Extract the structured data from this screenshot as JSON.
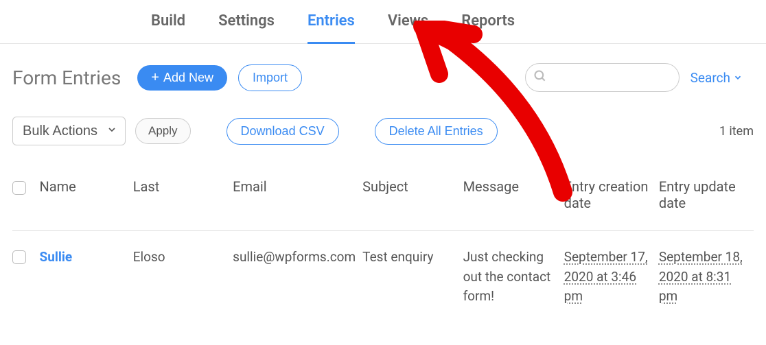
{
  "tabs": {
    "build": "Build",
    "settings": "Settings",
    "entries": "Entries",
    "views": "Views",
    "reports": "Reports",
    "active": "entries"
  },
  "header": {
    "title": "Form Entries",
    "add_new": "Add New",
    "import": "Import"
  },
  "search": {
    "placeholder": "",
    "dropdown": "Search"
  },
  "actions": {
    "bulk_label": "Bulk Actions",
    "apply": "Apply",
    "download_csv": "Download CSV",
    "delete_all": "Delete All Entries",
    "item_count": "1 item"
  },
  "table": {
    "headers": {
      "name": "Name",
      "last": "Last",
      "email": "Email",
      "subject": "Subject",
      "message": "Message",
      "created": "Entry creation date",
      "updated": "Entry update date"
    },
    "rows": [
      {
        "name": "Sullie",
        "last": "Eloso",
        "email": "sullie@wpforms.com",
        "subject": "Test enquiry",
        "message": "Just checking out the contact form!",
        "created": "September 17, 2020 at 3:46 pm",
        "updated": "September 18, 2020 at 8:31 pm"
      }
    ]
  }
}
